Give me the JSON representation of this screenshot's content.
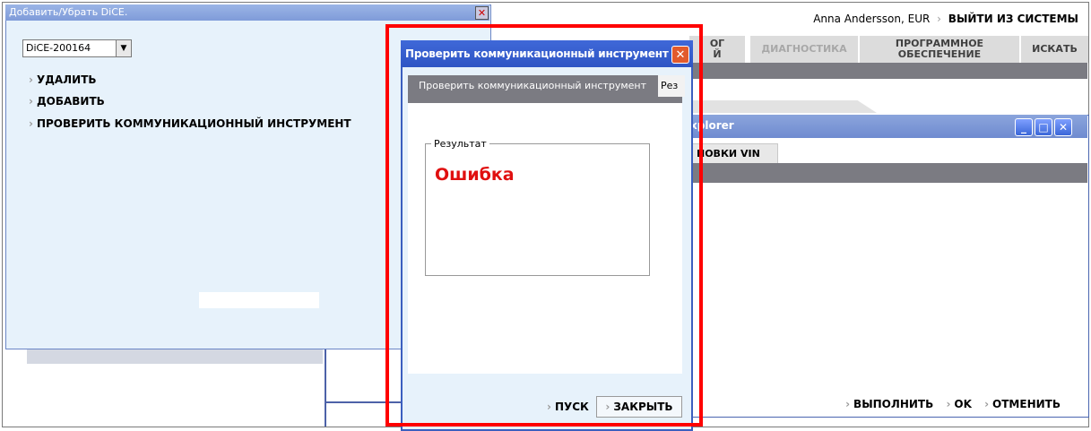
{
  "header": {
    "user": "Anna Andersson, EUR",
    "arrow": "›",
    "logout": "ВЫЙТИ ИЗ СИСТЕМЫ"
  },
  "tabs": {
    "partial": "ОГ\nЙ",
    "diagnostics": "ДИАГНОСТИКА",
    "software": "ПРОГРАММНОЕ\nОБЕСПЕЧЕНИЕ",
    "search": "ИСКАТЬ"
  },
  "explorer_window": {
    "title": "xplorer",
    "tab_partial": "НОВКИ VIN",
    "footer": {
      "execute": "ВЫПОЛНИТЬ",
      "ok": "OK",
      "cancel": "ОТМЕНИТЬ"
    }
  },
  "dice_window": {
    "title": "Добавить/Убрать DiCE.",
    "device_select": "DiCE-200164",
    "menu": [
      "УДАЛИТЬ",
      "ДОБАВИТЬ",
      "ПРОВЕРИТЬ КОММУНИКАЦИОННЫЙ ИНСТРУМЕНТ"
    ]
  },
  "dialog": {
    "title": "Проверить коммуникационный инструмент",
    "tabs": [
      "Проверить коммуникационный инструмент",
      "Рез"
    ],
    "group_label": "Результат",
    "result": "Ошибка",
    "run_button": "ПУСК",
    "close_button": "ЗАКРЫТЬ"
  },
  "colors": {
    "highlight": "#ff0000",
    "error": "#e01010",
    "dialog_title": "#2e55c4",
    "panel_bg": "#e7f2fb"
  },
  "icons": {
    "arrow": "chevron-right-icon",
    "close": "close-icon",
    "minimize": "minimize-icon",
    "maximize": "maximize-icon",
    "dropdown": "chevron-down-icon"
  }
}
